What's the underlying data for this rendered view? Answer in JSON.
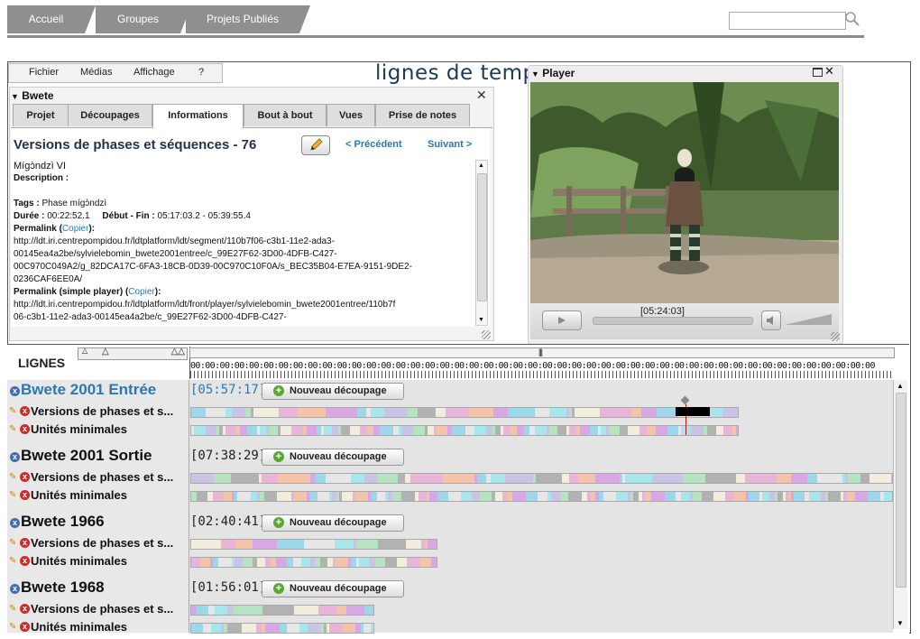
{
  "nav": {
    "tabs": [
      "Accueil",
      "Groupes",
      "Projets Publiés"
    ],
    "search_placeholder": ""
  },
  "menu": {
    "items": [
      "Fichier",
      "Médias",
      "Affichage",
      "?"
    ]
  },
  "logo": "lignes de temps",
  "project_panel": {
    "title": "Bwete",
    "tabs": [
      "Projet",
      "Découpages",
      "Informations",
      "Bout à bout",
      "Vues",
      "Prise de notes"
    ],
    "active_tab": "Informations",
    "heading": "Versions de phases et séquences - 76",
    "prev": "< Précédent",
    "next": "Suivant >",
    "item_title": "Mígɔ̀ndzì VI",
    "description_label": "Description :",
    "tags_label": "Tags :",
    "tags_value": "Phase mígɔ̀ndzì",
    "duration_label": "Durée :",
    "duration_value": "00:22:52.1",
    "range_label": "Début - Fin :",
    "range_value": "05:17:03.2 - 05:39:55.4",
    "permalink_label": "Permalink",
    "copy_label": "Copier",
    "permalink_lines": [
      "http://ldt.iri.centrepompidou.fr/ldtplatform/ldt/segment/110b7f06-c3b1-11e2-ada3-",
      "00145ea4a2be/sylvielebomin_bwete2001entree/c_99E27F62-3D00-4DFB-C427-",
      "00C970C049A2/g_82DCA17C-6FA3-18CB-0D39-00C970C10F0A/s_BEC35B04-E7EA-9151-9DE2-",
      "0236CAF6EE0A/"
    ],
    "permalink_simple_label": "Permalink (simple player)",
    "permalink_simple_lines": [
      "http://ldt.iri.centrepompidou.fr/ldtplatform/ldt/front/player/sylvielebomin_bwete2001entree/110b7f",
      "06-c3b1-11e2-ada3-00145ea4a2be/c_99E27F62-3D00-4DFB-C427-"
    ]
  },
  "player": {
    "title": "Player",
    "timecode": "[05:24:03]"
  },
  "timeline": {
    "title": "LIGNES",
    "ruler_text": "00:00:00:00:00:00:00:00:00:00:00:00:00:00:00:00:00:00:00:00:00:00:00:00:00:00:00:00:00:00:00:00:00:00:00:00:00:00:00:00:00:00:00:00:00:00:00",
    "new_cut_label": "Nouveau découpage",
    "groups": [
      {
        "name": "Bwete 2001 Entrée",
        "duration": "[05:57:17]",
        "rows": [
          "Versions de phases et s...",
          "Unités minimales"
        ],
        "fill": [
          0.78,
          0.78
        ]
      },
      {
        "name": "Bwete 2001 Sortie",
        "duration": "[07:38:29]",
        "rows": [
          "Versions de phases et s...",
          "Unités minimales"
        ],
        "fill": [
          1.0,
          1.0
        ]
      },
      {
        "name": "Bwete 1966",
        "duration": "[02:40:41]",
        "rows": [
          "Versions de phases et s...",
          "Unités minimales"
        ],
        "fill": [
          0.35,
          0.35
        ]
      },
      {
        "name": "Bwete 1968",
        "duration": "[01:56:01]",
        "rows": [
          "Versions de phases et s...",
          "Unités minimales"
        ],
        "fill": [
          0.26,
          0.26
        ]
      }
    ],
    "colors": [
      "#f2eddc",
      "#d9a6e6",
      "#a8e6ee",
      "#b2b2b2",
      "#f4c4a8",
      "#e7e7e7",
      "#b6e4c0",
      "#e8b4d8",
      "#9cd7ea",
      "#c9c3e6"
    ]
  }
}
